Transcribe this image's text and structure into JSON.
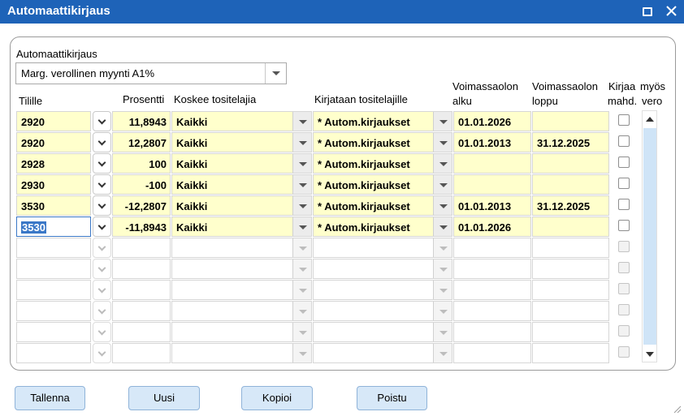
{
  "window": {
    "title": "Automaattikirjaus",
    "maximize_icon": "maximize-icon",
    "close_icon": "close-icon"
  },
  "form": {
    "template_label": "Automaattikirjaus",
    "template_value": "Marg. verollinen myynti A1%"
  },
  "grid": {
    "headers": {
      "account": "Tilille",
      "percent": "Prosentti",
      "voucher_types": "Koskee tositelajia",
      "posted_types_line1": "Kirjataan tositelajille",
      "valid_from_line1": "Voimassaolon",
      "valid_from_line2": "alku",
      "valid_to_line1": "Voimassaolon",
      "valid_to_line2": "loppu",
      "also_post_line1": "Kirjaa",
      "also_post_line2": "mahd.",
      "also_post_line3": "myös",
      "also_post_line4": "vero"
    },
    "rows": [
      {
        "account": "2920",
        "percent": "11,8943",
        "voucher_type": "Kaikki",
        "posted_type": "* Autom.kirjaukset",
        "valid_from": "01.01.2026",
        "valid_to": "",
        "checked": false
      },
      {
        "account": "2920",
        "percent": "12,2807",
        "voucher_type": "Kaikki",
        "posted_type": "* Autom.kirjaukset",
        "valid_from": "01.01.2013",
        "valid_to": "31.12.2025",
        "checked": false
      },
      {
        "account": "2928",
        "percent": "100",
        "voucher_type": "Kaikki",
        "posted_type": "* Autom.kirjaukset",
        "valid_from": "",
        "valid_to": "",
        "checked": false
      },
      {
        "account": "2930",
        "percent": "-100",
        "voucher_type": "Kaikki",
        "posted_type": "* Autom.kirjaukset",
        "valid_from": "",
        "valid_to": "",
        "checked": false
      },
      {
        "account": "3530",
        "percent": "-12,2807",
        "voucher_type": "Kaikki",
        "posted_type": "* Autom.kirjaukset",
        "valid_from": "01.01.2013",
        "valid_to": "31.12.2025",
        "checked": false
      },
      {
        "account": "3530",
        "percent": "-11,8943",
        "voucher_type": "Kaikki",
        "posted_type": "* Autom.kirjaukset",
        "valid_from": "01.01.2026",
        "valid_to": "",
        "checked": false
      }
    ],
    "empty_rows": 6,
    "selected_row": 6
  },
  "buttons": {
    "save": "Tallenna",
    "new": "Uusi",
    "copy": "Kopioi",
    "delete": "Poistu"
  },
  "colors": {
    "titlebar": "#1E63B8",
    "filled_cell": "#FFFFCC",
    "button_bg": "#D7E8F8",
    "scroll_track": "#CFE4F7"
  }
}
